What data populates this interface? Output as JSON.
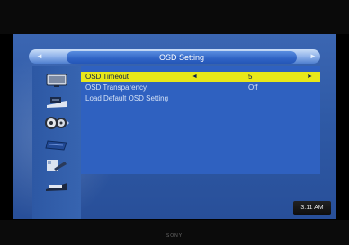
{
  "menu": {
    "title": "OSD Setting",
    "items": [
      {
        "label": "OSD Timeout",
        "value": "5",
        "selected": true
      },
      {
        "label": "OSD Transparency",
        "value": "Off",
        "selected": false
      },
      {
        "label": "Load Default OSD Setting",
        "value": "",
        "selected": false
      }
    ]
  },
  "icons": [
    "tv-icon",
    "picture-icon",
    "settings-gears-icon",
    "channel-list-icon",
    "tools-icon",
    "media-icon"
  ],
  "clock": {
    "time": "3:11 AM"
  },
  "colors": {
    "highlight": "#e8e81a",
    "background": "#2f61c0"
  }
}
